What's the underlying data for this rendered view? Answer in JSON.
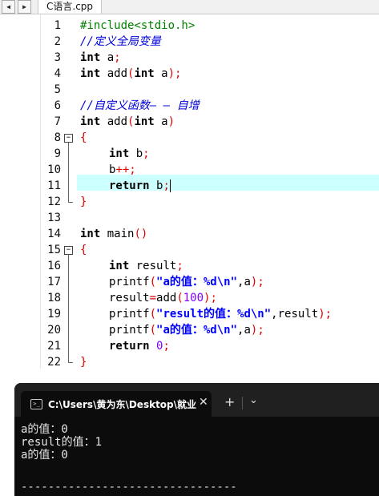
{
  "tabs": {
    "file_tab": "C语言.cpp",
    "nav_left": "◀",
    "nav_right": "▶"
  },
  "editor": {
    "lines": [
      {
        "n": "1"
      },
      {
        "n": "2"
      },
      {
        "n": "3"
      },
      {
        "n": "4"
      },
      {
        "n": "5"
      },
      {
        "n": "6"
      },
      {
        "n": "7"
      },
      {
        "n": "8"
      },
      {
        "n": "9"
      },
      {
        "n": "10"
      },
      {
        "n": "11"
      },
      {
        "n": "12"
      },
      {
        "n": "13"
      },
      {
        "n": "14"
      },
      {
        "n": "15"
      },
      {
        "n": "16"
      },
      {
        "n": "17"
      },
      {
        "n": "18"
      },
      {
        "n": "19"
      },
      {
        "n": "20"
      },
      {
        "n": "21"
      },
      {
        "n": "22"
      }
    ],
    "current_line": "11",
    "code": {
      "l1_include": "#include<stdio.h>",
      "l2_comment": "//定义全局变量",
      "l3_kw": "int",
      "l3_rest": " a",
      "l3_semi": ";",
      "l4_kw": "int",
      "l4_name": " add",
      "l4_paren1": "(",
      "l4_kw2": "int",
      "l4_arg": " a",
      "l4_paren2": ");",
      "l6_comment": "//自定义函数— — 自增",
      "l7_kw": "int",
      "l7_name": " add",
      "l7_paren1": "(",
      "l7_kw2": "int",
      "l7_arg": " a",
      "l7_paren2": ")",
      "l8_brace": "{",
      "l9_kw": "int",
      "l9_rest": " b",
      "l9_semi": ";",
      "l10_var": "b",
      "l10_op": "++;",
      "l11_kw": "return",
      "l11_rest": " b",
      "l11_semi": ";",
      "l12_brace": "}",
      "l14_kw": "int",
      "l14_name": " main",
      "l14_paren": "()",
      "l15_brace": "{",
      "l16_kw": "int",
      "l16_rest": " result",
      "l16_semi": ";",
      "l17_fn": "printf",
      "l17_p1": "(",
      "l17_str": "\"a的值：%d\\n\"",
      "l17_mid": ",a",
      "l17_p2": ");",
      "l18_var": "result",
      "l18_eq": "=",
      "l18_fn": "add",
      "l18_p1": "(",
      "l18_num": "100",
      "l18_p2": ");",
      "l19_fn": "printf",
      "l19_p1": "(",
      "l19_str": "\"result的值：%d\\n\"",
      "l19_mid": ",result",
      "l19_p2": ");",
      "l20_fn": "printf",
      "l20_p1": "(",
      "l20_str": "\"a的值：%d\\n\"",
      "l20_mid": ",a",
      "l20_p2": ");",
      "l21_kw": "return",
      "l21_num": " 0",
      "l21_semi": ";",
      "l22_brace": "}"
    },
    "fold_symbol": "−"
  },
  "terminal": {
    "tab_title": "C:\\Users\\黄为东\\Desktop\\就业",
    "close_label": "✕",
    "new_tab_label": "+",
    "dropdown_label": "⌄",
    "icon_label": ">_",
    "output": "a的值：0\nresult的值：1\na的值：0",
    "separator": "--------------------------------"
  },
  "colors": {
    "keyword": "#000000",
    "preprocessor": "#008000",
    "comment": "#0000dd",
    "operator": "#e00000",
    "string": "#0000ff",
    "number": "#8000ff",
    "current_line_bg": "#ccffff",
    "terminal_bg": "#0c0c0c"
  }
}
